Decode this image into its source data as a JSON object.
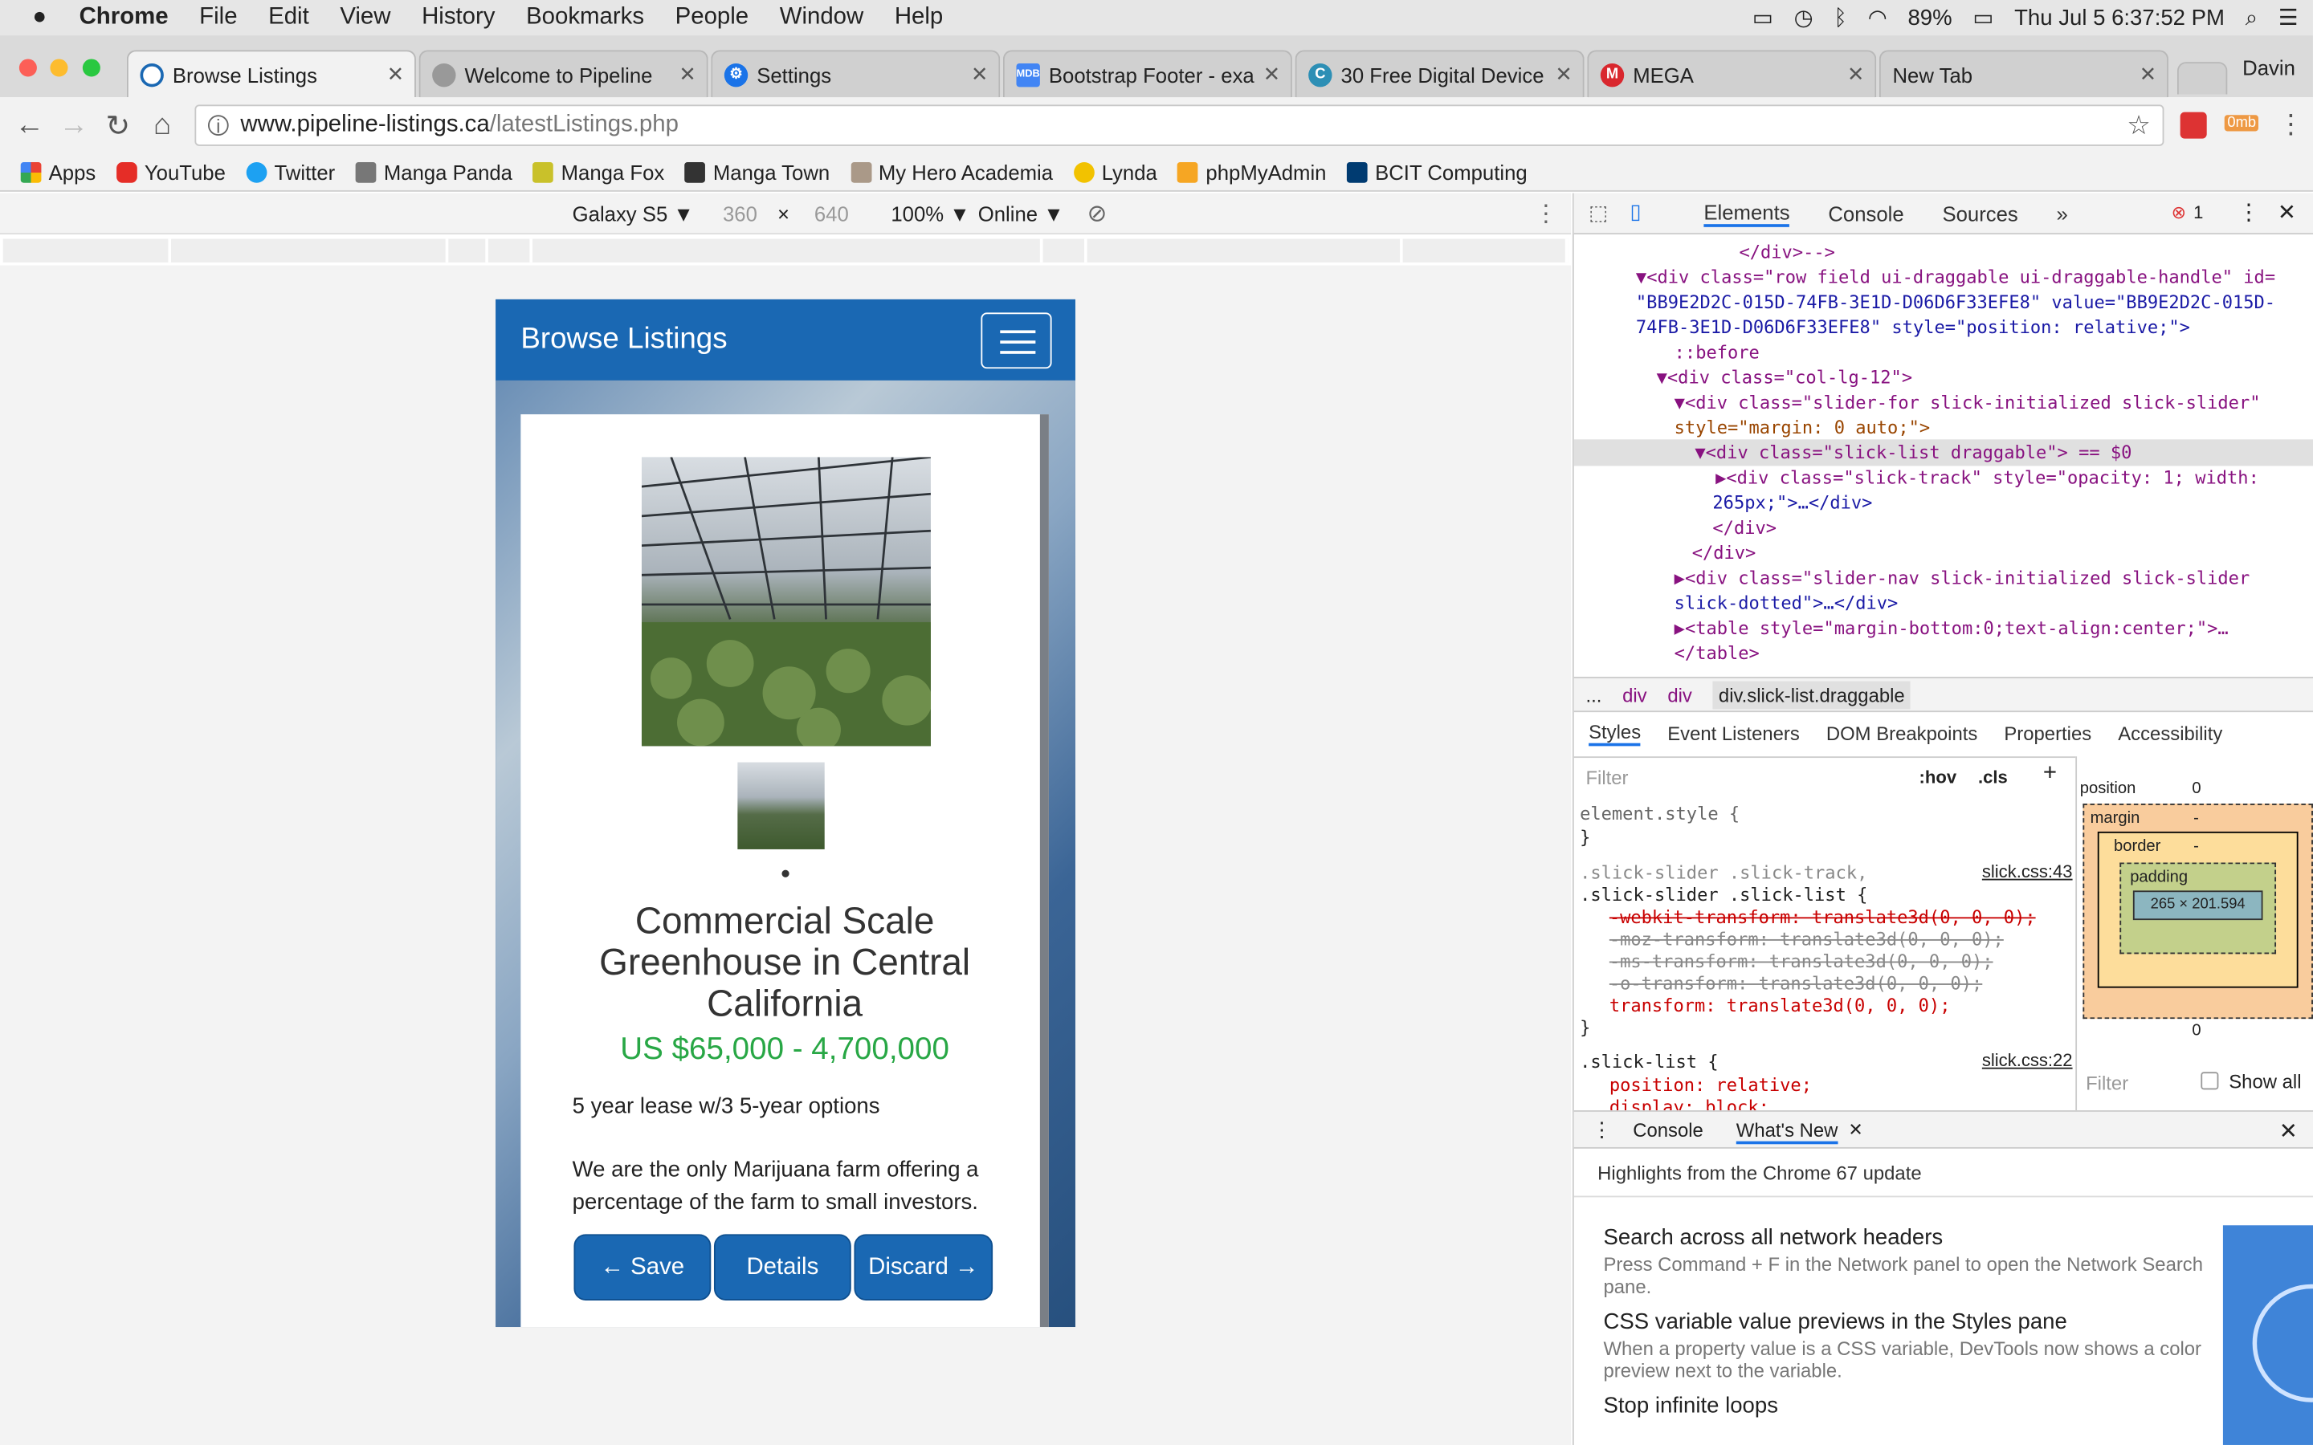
{
  "menubar": {
    "app": "Chrome",
    "items": [
      "File",
      "Edit",
      "View",
      "History",
      "Bookmarks",
      "People",
      "Window",
      "Help"
    ],
    "battery": "89%",
    "clock": "Thu Jul 5  6:37:52 PM"
  },
  "tabs": [
    {
      "title": "Browse Listings",
      "active": true
    },
    {
      "title": "Welcome to Pipeline"
    },
    {
      "title": "Settings"
    },
    {
      "title": "Bootstrap Footer - exa"
    },
    {
      "title": "30 Free Digital Device"
    },
    {
      "title": "MEGA"
    },
    {
      "title": "New Tab"
    }
  ],
  "profile": "Davin",
  "address": {
    "host": "www.pipeline-listings.ca",
    "path": "/latestListings.php"
  },
  "extension_badge": "0mb",
  "bookmarks": [
    "Apps",
    "YouTube",
    "Twitter",
    "Manga Panda",
    "Manga Fox",
    "Manga Town",
    "My Hero Academia",
    "Lynda",
    "phpMyAdmin",
    "BCIT Computing"
  ],
  "device_toolbar": {
    "device": "Galaxy S5 ▼",
    "width": "360",
    "x": "×",
    "height": "640",
    "zoom": "100% ▼",
    "network": "Online ▼"
  },
  "phone": {
    "nav_title": "Browse Listings",
    "title": "Commercial Scale Greenhouse in Central California",
    "price": "US $65,000 - 4,700,000",
    "desc1": "5 year lease w/3 5-year options",
    "desc2": "We are the only Marijuana farm offering a percentage of the farm to small investors.",
    "buttons": {
      "save": "← Save",
      "details": "Details",
      "discard": "Discard →"
    }
  },
  "devtools": {
    "tabs": [
      "Elements",
      "Console",
      "Sources",
      "»"
    ],
    "error_count": "1",
    "dom": [
      "</div>-->",
      "<div class=\"row field ui-draggable ui-draggable-handle\" id=",
      "\"BB9E2D2C-015D-74FB-3E1D-D06D6F33EFE8\" value=\"BB9E2D2C-015D-",
      "74FB-3E1D-D06D6F33EFE8\" style=\"position: relative;\">",
      "::before",
      "<div class=\"col-lg-12\">",
      "<div class=\"slider-for slick-initialized slick-slider\"",
      "style=\"margin: 0 auto;\">",
      "<div class=\"slick-list draggable\"> == $0",
      "<div class=\"slick-track\" style=\"opacity: 1; width:",
      "265px;\">…</div>",
      "</div>",
      "</div>",
      "<div class=\"slider-nav slick-initialized slick-slider",
      "slick-dotted\">…</div>",
      "<table style=\"margin-bottom:0;text-align:center;\">…",
      "</table>"
    ],
    "breadcrumb": [
      "...",
      "div",
      "div",
      "div.slick-list.draggable"
    ],
    "subtabs": [
      "Styles",
      "Event Listeners",
      "DOM Breakpoints",
      "Properties",
      "Accessibility"
    ],
    "filter_placeholder": "Filter",
    "hov": ":hov",
    "cls": ".cls",
    "styles": [
      "element.style {",
      "}",
      ".slick-slider .slick-track,",
      ".slick-slider .slick-list {",
      "-webkit-transform: translate3d(0, 0, 0);",
      "-moz-transform: translate3d(0, 0, 0);",
      "-ms-transform: translate3d(0, 0, 0);",
      "-o-transform: translate3d(0, 0, 0);",
      "transform: translate3d(0, 0, 0);",
      "}",
      ".slick-list {",
      "position: relative;",
      "display: block;"
    ],
    "style_links": [
      "slick.css:43",
      "slick.css:22"
    ],
    "boxmodel": {
      "position": "position",
      "pos_val": "0",
      "margin": "margin",
      "border": "border",
      "padding": "padding",
      "size": "265 × 201.594",
      "dash": "-",
      "bottom": "0"
    },
    "computed_filter": "Filter",
    "show_all": "Show all",
    "drawer_tabs": [
      "Console",
      "What's New"
    ],
    "whatsnew_header": "Highlights from the Chrome 67 update",
    "news": [
      {
        "title": "Search across all network headers",
        "body": "Press Command + F in the Network panel to open the Network Search pane."
      },
      {
        "title": "CSS variable value previews in the Styles pane",
        "body": "When a property value is a CSS variable, DevTools now shows a color preview next to the variable."
      },
      {
        "title": "Stop infinite loops",
        "body": ""
      }
    ]
  }
}
